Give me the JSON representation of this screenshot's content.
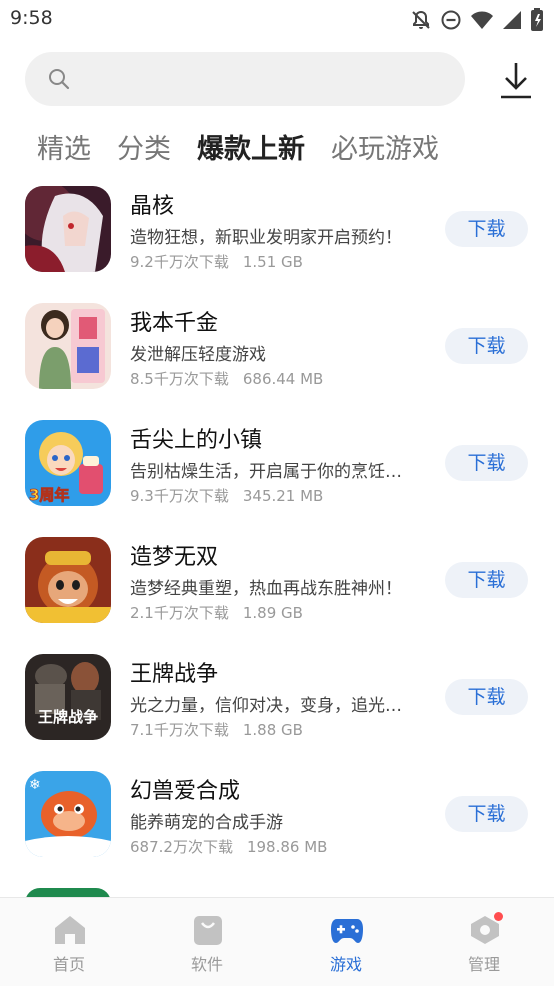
{
  "status_bar": {
    "time": "9:58"
  },
  "search": {
    "placeholder": ""
  },
  "tabs": [
    {
      "label": "精选",
      "active": false
    },
    {
      "label": "分类",
      "active": false
    },
    {
      "label": "爆款上新",
      "active": true
    },
    {
      "label": "必玩游戏",
      "active": false
    }
  ],
  "apps": [
    {
      "name": "晶核",
      "desc": "造物狂想，新职业发明家开启预约！",
      "downloads": "9.2千万次下载",
      "size": "1.51 GB",
      "button": "下载"
    },
    {
      "name": "我本千金",
      "desc": "发泄解压轻度游戏",
      "downloads": "8.5千万次下载",
      "size": "686.44 MB",
      "button": "下载"
    },
    {
      "name": "舌尖上的小镇",
      "desc": "告别枯燥生活，开启属于你的烹饪…",
      "downloads": "9.3千万次下载",
      "size": "345.21 MB",
      "button": "下载"
    },
    {
      "name": "造梦无双",
      "desc": "造梦经典重塑，热血再战东胜神州！",
      "downloads": "2.1千万次下载",
      "size": "1.89 GB",
      "button": "下载"
    },
    {
      "name": "王牌战争",
      "desc": "光之力量，信仰对决，变身，追光…",
      "downloads": "7.1千万次下载",
      "size": "1.88 GB",
      "button": "下载"
    },
    {
      "name": "幻兽爱合成",
      "desc": "能养萌宠的合成手游",
      "downloads": "687.2万次下载",
      "size": "198.86 MB",
      "button": "下载"
    }
  ],
  "icon_texts": {
    "app3_badge": "3周年",
    "app5_logo": "王牌战争"
  },
  "bottom_nav": [
    {
      "label": "首页",
      "icon": "home-icon"
    },
    {
      "label": "软件",
      "icon": "bag-icon"
    },
    {
      "label": "游戏",
      "icon": "gamepad-icon",
      "active": true
    },
    {
      "label": "管理",
      "icon": "manage-icon",
      "badge": true
    }
  ],
  "colors": {
    "accent": "#2a6fd6",
    "badge": "#ff4d4f",
    "button_bg": "#eef2f8"
  }
}
